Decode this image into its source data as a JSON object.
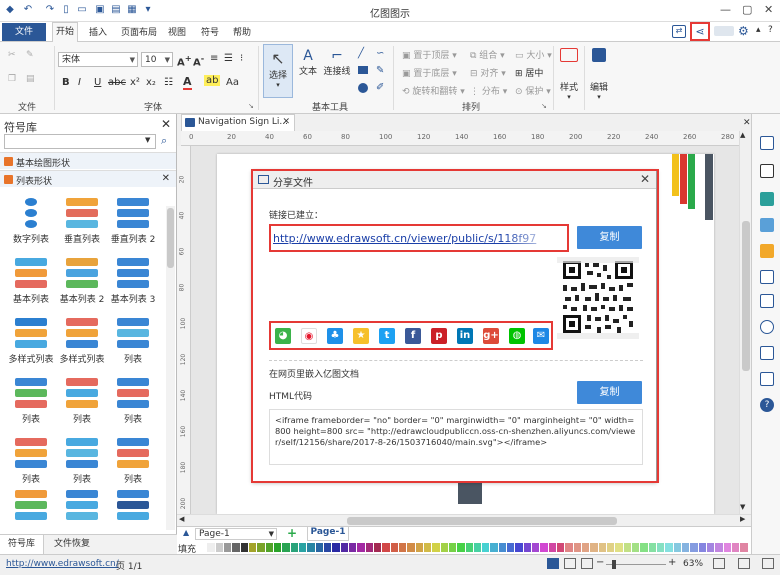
{
  "app": {
    "title": "亿图图示"
  },
  "menu": {
    "file": "文件",
    "items": [
      "开始",
      "插入",
      "页面布局",
      "视图",
      "符号",
      "帮助"
    ]
  },
  "ribbon": {
    "font_name": "宋体",
    "font_size": "10",
    "groups": {
      "file": "文件",
      "font": "字体",
      "basic_tools": "基本工具",
      "arrange": "排列"
    },
    "select_label": "选择",
    "text_label": "文本",
    "connector_label": "连接线",
    "style_label": "样式",
    "edit_label": "编辑",
    "arrange_items": [
      "置于顶层",
      "组合",
      "大小",
      "置于底层",
      "对齐",
      "居中",
      "旋转和翻转",
      "分布",
      "保护"
    ]
  },
  "library": {
    "title": "符号库",
    "categories": [
      "基本绘图形状",
      "列表形状"
    ],
    "shapes": [
      "数字列表",
      "垂直列表",
      "垂直列表 2",
      "基本列表",
      "基本列表 2",
      "基本列表 3",
      "多样式列表",
      "多样式列表",
      "列表",
      "列表",
      "列表",
      "列表",
      "列表",
      "列表",
      "列表",
      "列表",
      "列表",
      "列表"
    ],
    "tabs": [
      "符号库",
      "文件恢复"
    ]
  },
  "document": {
    "tab_label": "Navigation Sign Li...",
    "ruler_ticks": [
      "0",
      "20",
      "40",
      "60",
      "80",
      "100",
      "120",
      "140",
      "160",
      "180",
      "200",
      "220",
      "240",
      "260",
      "280"
    ],
    "ruler_left_ticks": [
      "20",
      "40",
      "60",
      "80",
      "100",
      "120",
      "140",
      "160",
      "180",
      "200"
    ]
  },
  "dialog": {
    "title": "分享文件",
    "link_created": "链接已建立：",
    "link_url": "http://www.edrawsoft.cn/viewer/public/s/118f97",
    "copy_button": "复制",
    "embed_title": "在网页里嵌入亿图文档",
    "html_code_label": "HTML代码",
    "copy_button2": "复制",
    "embed_code": "<iframe frameborder= \"no\" border= \"0\" marginwidth= \"0\" marginheight= \"0\" width=800 height=800 src= \"http://edrawcloudpubliccn.oss-cn-shenzhen.aliyuncs.com/viewer/self/12156/share/2017-8-26/1503716040/main.svg\"></iframe>",
    "social_icons": [
      "wechat-icon",
      "weibo-icon",
      "qq-icon",
      "qzone-icon",
      "twitter-icon",
      "facebook-icon",
      "pinterest-icon",
      "linkedin-icon",
      "google-plus-icon",
      "line-icon",
      "email-icon"
    ]
  },
  "pages": {
    "page_selector": "Page-1",
    "active_tab": "Page-1",
    "fill_label": "填充"
  },
  "status": {
    "url": "http://www.edrawsoft.cn/",
    "page_info": "页 1/1",
    "zoom": "63%"
  },
  "colors": {
    "accent": "#2b5797",
    "red_highlight": "#e53935",
    "button_blue": "#3f89d9"
  }
}
